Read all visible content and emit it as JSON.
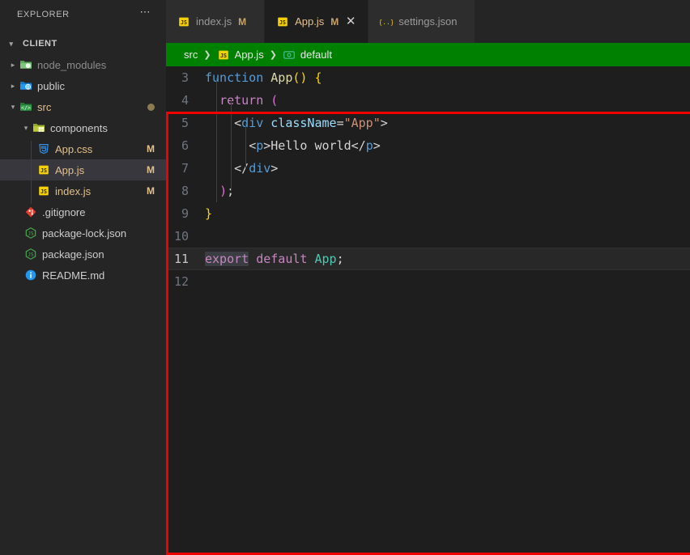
{
  "sidebar": {
    "title": "EXPLORER",
    "more_icon": "ellipsis-icon",
    "root": {
      "label": "CLIENT",
      "chevron": "chevron-down-icon"
    },
    "items": [
      {
        "label": "node_modules",
        "icon": "folder-node-modules-icon",
        "chevron": "chevron-right-icon",
        "badge": "",
        "state": "collapsed",
        "depth": 1,
        "tone": "dim"
      },
      {
        "label": "public",
        "icon": "folder-public-icon",
        "chevron": "chevron-right-icon",
        "badge": "",
        "state": "collapsed",
        "depth": 1,
        "tone": "normal"
      },
      {
        "label": "src",
        "icon": "folder-src-icon",
        "chevron": "chevron-down-icon",
        "badge": "dot",
        "state": "expanded",
        "depth": 1,
        "tone": "modified"
      },
      {
        "label": "components",
        "icon": "folder-components-icon",
        "chevron": "chevron-down-icon",
        "badge": "",
        "state": "expanded",
        "depth": 2,
        "tone": "normal"
      },
      {
        "label": "App.css",
        "icon": "css-file-icon",
        "chevron": "",
        "badge": "M",
        "state": "",
        "depth": 3,
        "tone": "modified"
      },
      {
        "label": "App.js",
        "icon": "js-file-icon",
        "chevron": "",
        "badge": "M",
        "state": "selected",
        "depth": 3,
        "tone": "modified"
      },
      {
        "label": "index.js",
        "icon": "js-file-icon",
        "chevron": "",
        "badge": "M",
        "state": "",
        "depth": 3,
        "tone": "modified"
      },
      {
        "label": ".gitignore",
        "icon": "git-file-icon",
        "chevron": "",
        "badge": "",
        "state": "",
        "depth": 2,
        "tone": "normal"
      },
      {
        "label": "package-lock.json",
        "icon": "npm-file-icon",
        "chevron": "",
        "badge": "",
        "state": "",
        "depth": 2,
        "tone": "normal"
      },
      {
        "label": "package.json",
        "icon": "npm-file-icon",
        "chevron": "",
        "badge": "",
        "state": "",
        "depth": 2,
        "tone": "normal"
      },
      {
        "label": "README.md",
        "icon": "info-file-icon",
        "chevron": "",
        "badge": "",
        "state": "",
        "depth": 2,
        "tone": "normal"
      }
    ]
  },
  "tabs": [
    {
      "label": "index.js",
      "icon": "js-file-icon",
      "dirty": "M",
      "active": false,
      "closable": false
    },
    {
      "label": "App.js",
      "icon": "js-file-icon",
      "dirty": "M",
      "active": true,
      "closable": true,
      "close_icon": "close-icon"
    },
    {
      "label": "settings.json",
      "icon": "json-file-icon",
      "dirty": "",
      "active": false,
      "closable": false
    }
  ],
  "breadcrumbs": {
    "background": "#008000",
    "separator": "›",
    "crumbs": [
      {
        "label": "src",
        "icon": ""
      },
      {
        "label": "App.js",
        "icon": "js-file-icon"
      },
      {
        "label": "default",
        "icon": "symbol-variable-icon"
      }
    ]
  },
  "editor": {
    "language": "javascript",
    "active_line": 11,
    "selection_text": "export",
    "first_visible_line": 3,
    "lines": [
      {
        "n": "3",
        "text": "function App() {"
      },
      {
        "n": "4",
        "text": "  return ("
      },
      {
        "n": "5",
        "text": "    <div className=\"App\">"
      },
      {
        "n": "6",
        "text": "      <p>Hello world</p>"
      },
      {
        "n": "7",
        "text": "    </div>"
      },
      {
        "n": "8",
        "text": "  );"
      },
      {
        "n": "9",
        "text": "}"
      },
      {
        "n": "10",
        "text": ""
      },
      {
        "n": "11",
        "text": "export default App;"
      },
      {
        "n": "12",
        "text": ""
      }
    ]
  },
  "overlay": {
    "highlight_color": "#f00000",
    "name": "editor-region-highlight"
  }
}
